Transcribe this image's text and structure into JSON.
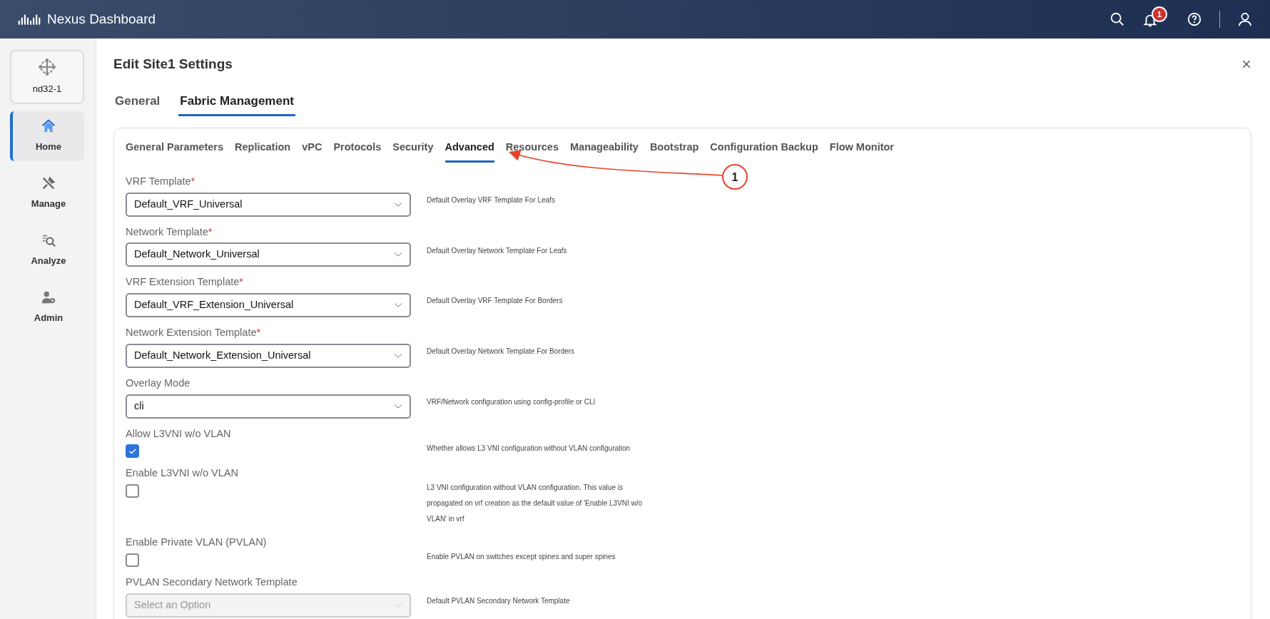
{
  "header": {
    "product": "Nexus Dashboard",
    "notification_count": "1"
  },
  "sidebar": {
    "site": {
      "label": "nd32-1"
    },
    "items": [
      {
        "label": "Home",
        "selected": true
      },
      {
        "label": "Manage",
        "selected": false
      },
      {
        "label": "Analyze",
        "selected": false
      },
      {
        "label": "Admin",
        "selected": false
      }
    ]
  },
  "dialog": {
    "title": "Edit Site1 Settings",
    "tabs": [
      {
        "label": "General",
        "selected": false
      },
      {
        "label": "Fabric Management",
        "selected": true
      }
    ],
    "subtabs": [
      {
        "label": "General Parameters",
        "selected": false
      },
      {
        "label": "Replication",
        "selected": false
      },
      {
        "label": "vPC",
        "selected": false
      },
      {
        "label": "Protocols",
        "selected": false
      },
      {
        "label": "Security",
        "selected": false
      },
      {
        "label": "Advanced",
        "selected": true
      },
      {
        "label": "Resources",
        "selected": false
      },
      {
        "label": "Manageability",
        "selected": false
      },
      {
        "label": "Bootstrap",
        "selected": false
      },
      {
        "label": "Configuration Backup",
        "selected": false
      },
      {
        "label": "Flow Monitor",
        "selected": false
      }
    ],
    "callout": {
      "label": "1"
    },
    "fields": [
      {
        "kind": "select",
        "label": "VRF Template",
        "required_mark": "*",
        "value": "Default_VRF_Universal",
        "help": "Default Overlay VRF Template For Leafs"
      },
      {
        "kind": "select",
        "label": "Network Template",
        "required_mark": "*",
        "value": "Default_Network_Universal",
        "help": "Default Overlay Network Template For Leafs"
      },
      {
        "kind": "select",
        "label": "VRF Extension Template",
        "required_mark": "*",
        "value": "Default_VRF_Extension_Universal",
        "help": "Default Overlay VRF Template For Borders"
      },
      {
        "kind": "select",
        "label": "Network Extension Template",
        "required_mark": "*",
        "value": "Default_Network_Extension_Universal",
        "help": "Default Overlay Network Template For Borders"
      },
      {
        "kind": "select",
        "label": "Overlay Mode",
        "value": "cli",
        "help": "VRF/Network configuration using config-profile or CLI"
      },
      {
        "kind": "checkbox",
        "label": "Allow L3VNI w/o VLAN",
        "checked": true,
        "help": "Whether allows L3 VNI configuration without VLAN configuration"
      },
      {
        "kind": "checkbox",
        "label": "Enable L3VNI w/o VLAN",
        "checked": false,
        "help": "L3 VNI configuration without VLAN configuration. This value is propagated on vrf creation as the default value of 'Enable L3VNI w/o VLAN' in vrf"
      },
      {
        "kind": "checkbox",
        "label": "Enable Private VLAN (PVLAN)",
        "checked": false,
        "help": "Enable PVLAN on switches except spines and super spines"
      },
      {
        "kind": "select",
        "label": "PVLAN Secondary Network Template",
        "disabled": true,
        "placeholder": "Select an Option",
        "help": "Default PVLAN Secondary Network Template"
      }
    ]
  }
}
